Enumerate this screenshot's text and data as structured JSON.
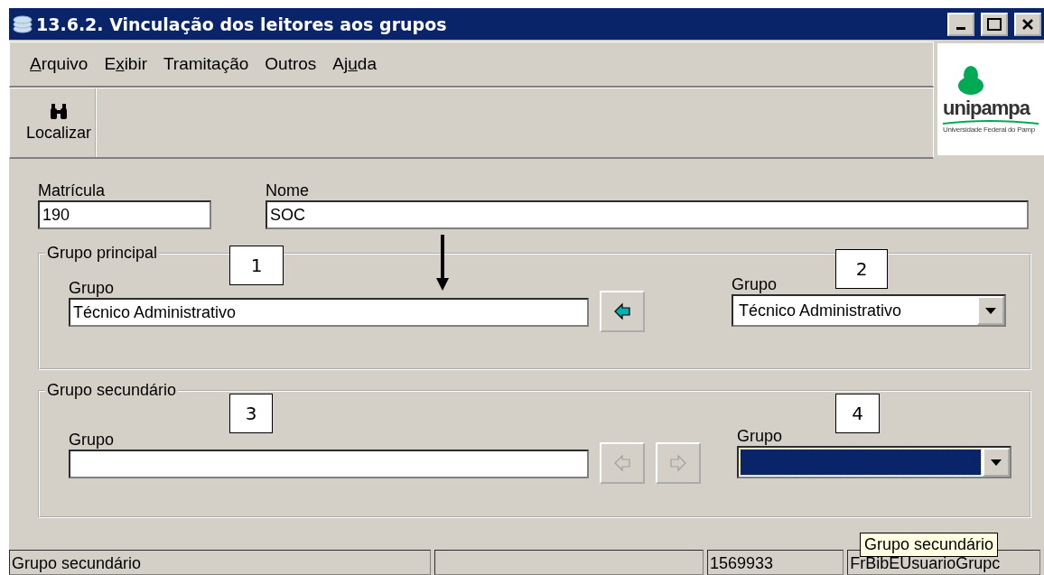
{
  "window": {
    "title": "13.6.2. Vinculação dos leitores aos grupos"
  },
  "menu": [
    {
      "key": "A",
      "after": "rquivo"
    },
    {
      "before": "E",
      "key": "x",
      "after": "ibir"
    },
    {
      "before": "Tramitação"
    },
    {
      "before": "Outros"
    },
    {
      "before": "Aj",
      "key": "u",
      "after": "da"
    }
  ],
  "toolbar": [
    {
      "label": "Localizar"
    }
  ],
  "logo": {
    "name": "unipampa",
    "subtitle": "Universidade Federal do Pamp"
  },
  "matricula": {
    "label": "Matrícula",
    "value": "190"
  },
  "nome": {
    "label": "Nome",
    "value": "SOC"
  },
  "groups": [
    {
      "legend": "Grupo principal",
      "field": {
        "label": "Grupo",
        "value": "Técnico Administrativo"
      },
      "buttons": [
        {
          "kind": "left",
          "disabled": false
        }
      ],
      "dropdown": {
        "label": "Grupo",
        "value": "Técnico Administrativo",
        "focused": false
      }
    },
    {
      "legend": "Grupo secundário",
      "field": {
        "label": "Grupo"
      },
      "buttons": [
        {
          "kind": "left",
          "disabled": true
        },
        {
          "kind": "right",
          "disabled": true
        }
      ],
      "dropdown": {
        "label": "Grupo",
        "focused": true
      }
    }
  ],
  "annotations": [
    {
      "label": "1"
    },
    {
      "label": "2"
    },
    {
      "label": "3"
    },
    {
      "label": "4"
    }
  ],
  "status_bar": [
    {
      "kind": "text",
      "text": "Grupo secundário"
    },
    {
      "kind": "blank"
    },
    {
      "kind": "text",
      "text": "1569933"
    },
    {
      "kind": "text",
      "text": "FrBibEUsuarioGrupc"
    }
  ],
  "tooltip": {
    "text": "Grupo secundário"
  }
}
